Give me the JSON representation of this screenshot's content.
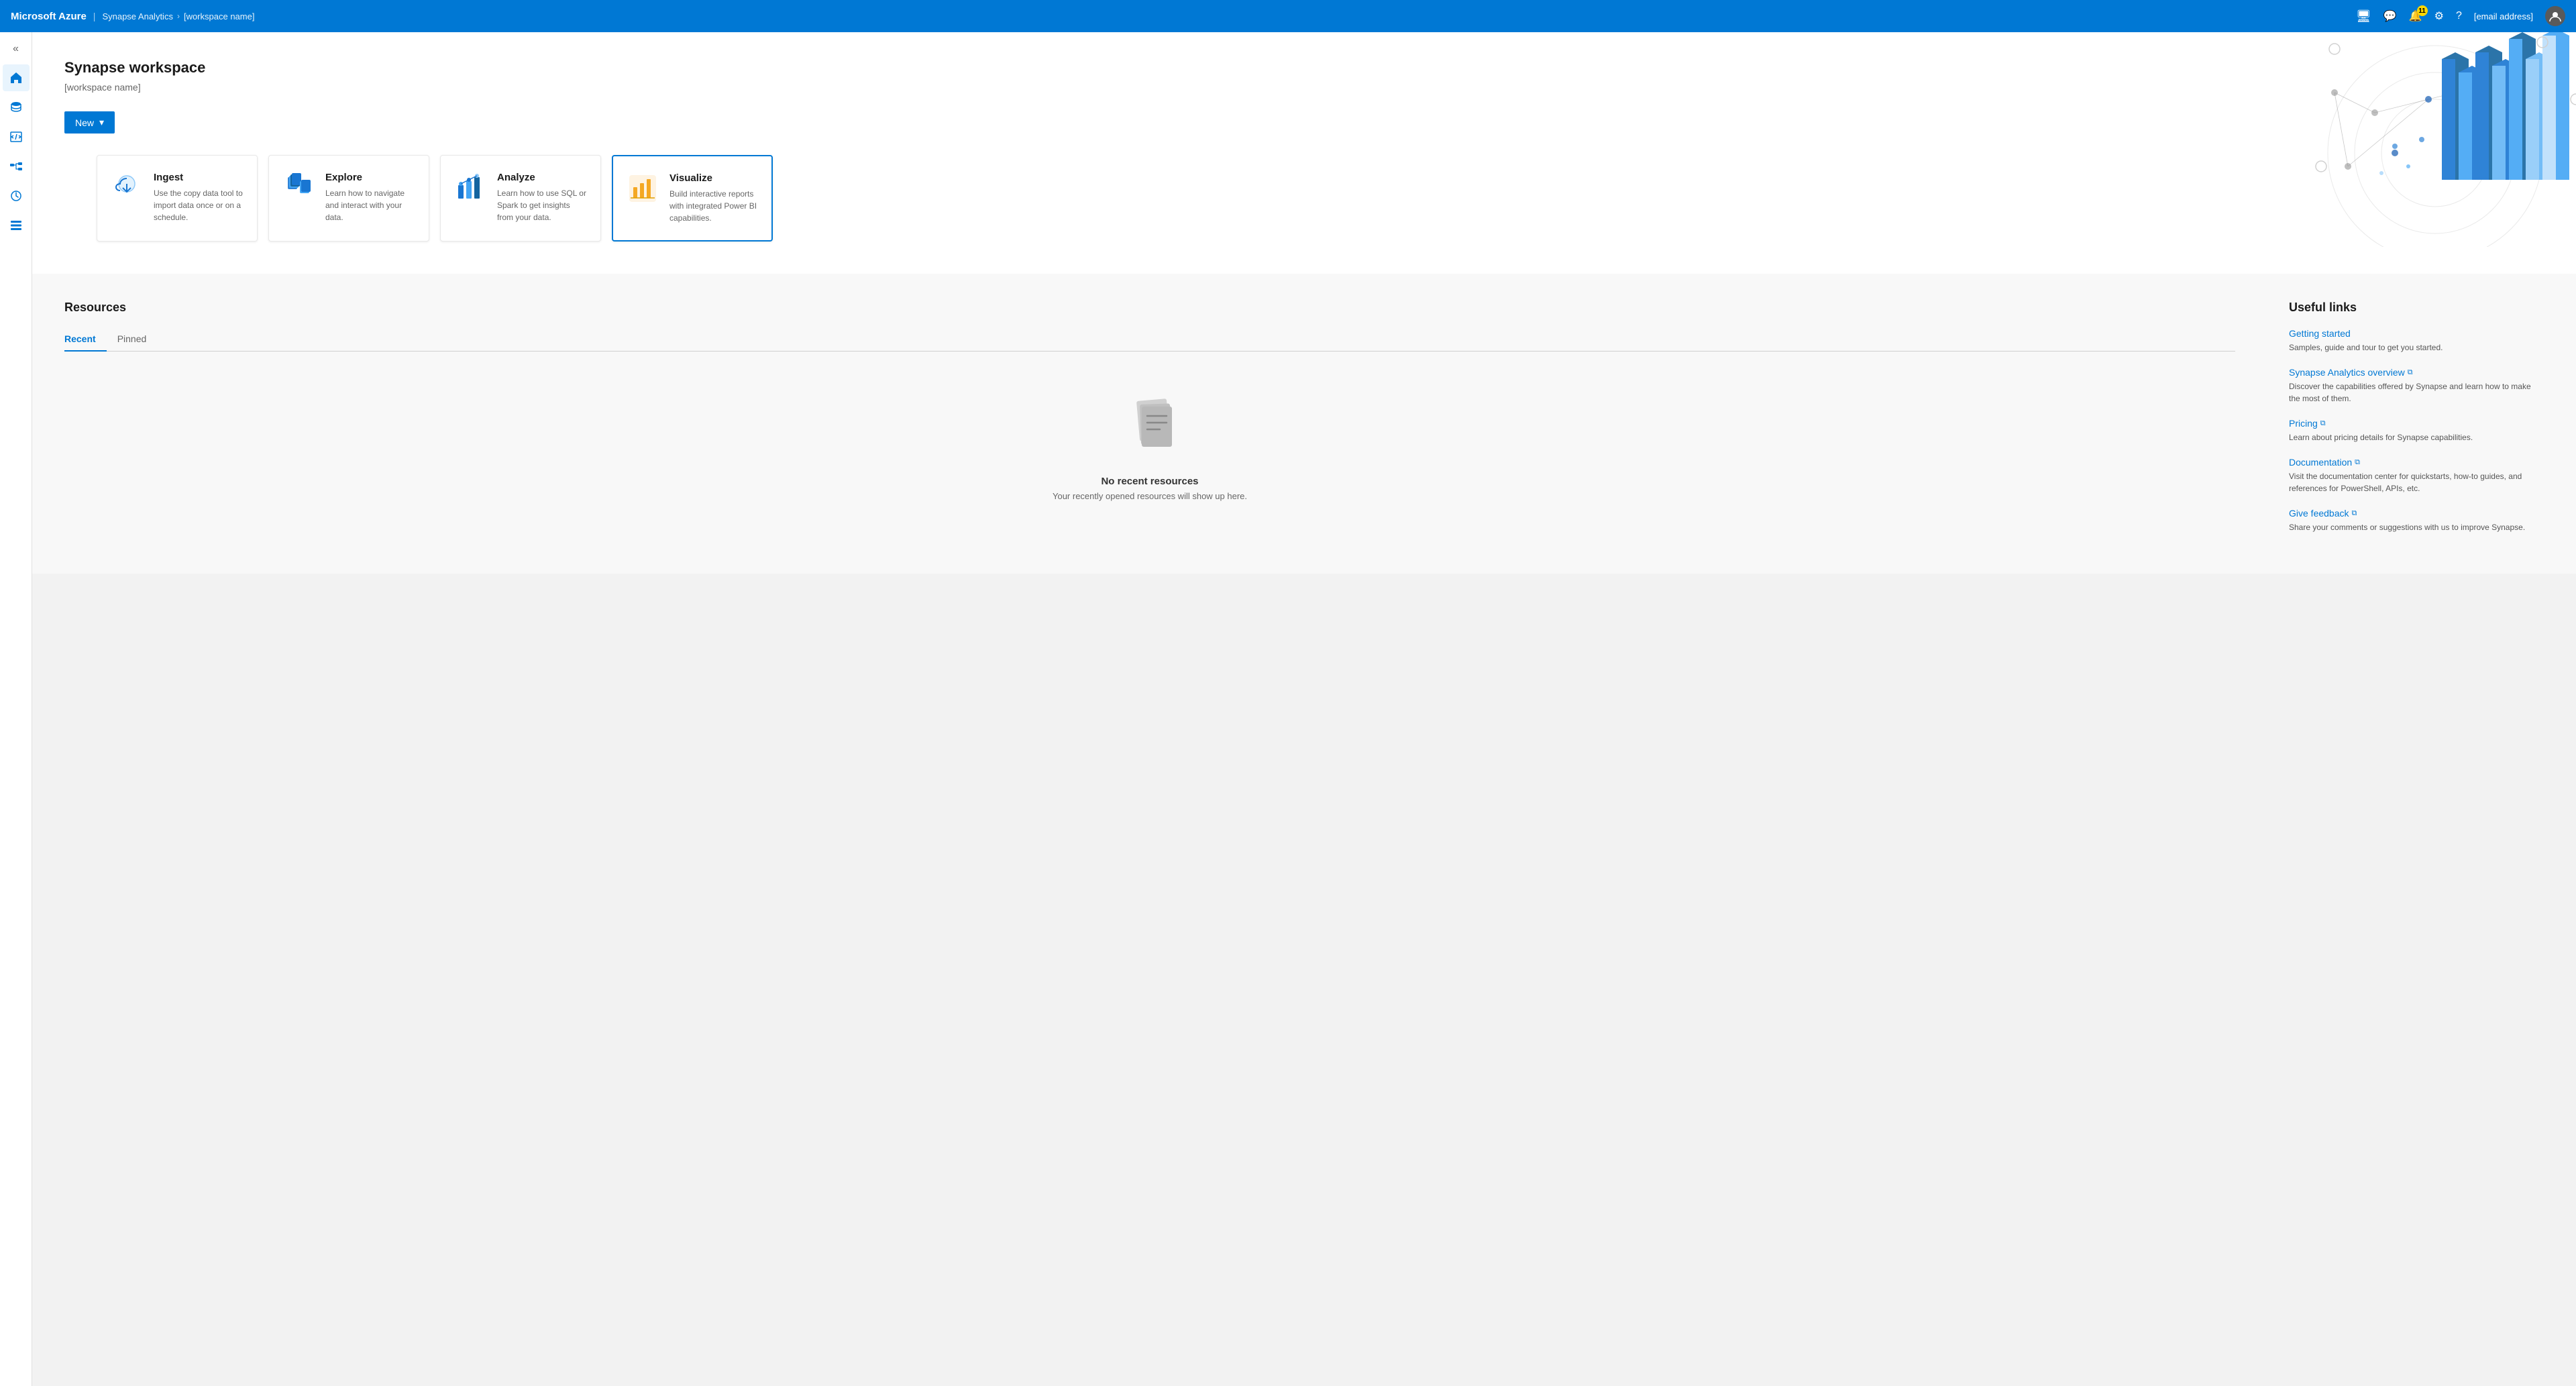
{
  "app": {
    "brand": "Microsoft Azure",
    "separator": "|",
    "nav_item1": "Synapse Analytics",
    "nav_arrow": "›",
    "nav_item2": "[workspace name]"
  },
  "topnav": {
    "notification_count": "11",
    "user_email": "[email address]"
  },
  "topnav_icons": [
    {
      "name": "cloud-icon",
      "symbol": "⊞"
    },
    {
      "name": "feedback-icon",
      "symbol": "💬"
    },
    {
      "name": "bell-icon",
      "symbol": "🔔"
    },
    {
      "name": "person-icon",
      "symbol": "👤"
    },
    {
      "name": "help-icon",
      "symbol": "?"
    }
  ],
  "sidebar": {
    "toggle_label": "«",
    "items": [
      {
        "name": "home",
        "icon": "⌂",
        "label": "Home"
      },
      {
        "name": "data",
        "icon": "🗄",
        "label": "Data"
      },
      {
        "name": "develop",
        "icon": "📄",
        "label": "Develop"
      },
      {
        "name": "integrate",
        "icon": "🔗",
        "label": "Integrate"
      },
      {
        "name": "monitor",
        "icon": "⏱",
        "label": "Monitor"
      },
      {
        "name": "manage",
        "icon": "💼",
        "label": "Manage"
      }
    ]
  },
  "hero": {
    "title": "Synapse workspace",
    "subtitle": "[workspace name]",
    "new_button": "New",
    "new_button_arrow": "▾"
  },
  "action_cards": [
    {
      "id": "ingest",
      "title": "Ingest",
      "description": "Use the copy data tool to import data once or on a schedule.",
      "icon_color": "#0078d4"
    },
    {
      "id": "explore",
      "title": "Explore",
      "description": "Learn how to navigate and interact with your data.",
      "icon_color": "#0078d4"
    },
    {
      "id": "analyze",
      "title": "Analyze",
      "description": "Learn how to use SQL or Spark to get insights from your data.",
      "icon_color": "#0078d4"
    },
    {
      "id": "visualize",
      "title": "Visualize",
      "description": "Build interactive reports with integrated Power BI capabilities.",
      "icon_color": "#f4b400",
      "highlighted": true
    }
  ],
  "resources": {
    "title": "Resources",
    "tabs": [
      {
        "id": "recent",
        "label": "Recent",
        "active": true
      },
      {
        "id": "pinned",
        "label": "Pinned",
        "active": false
      }
    ],
    "empty_title": "No recent resources",
    "empty_desc": "Your recently opened resources will show up here."
  },
  "useful_links": {
    "title": "Useful links",
    "items": [
      {
        "id": "getting-started",
        "title": "Getting started",
        "description": "Samples, guide and tour to get you started.",
        "external": false
      },
      {
        "id": "synapse-overview",
        "title": "Synapse Analytics overview",
        "description": "Discover the capabilities offered by Synapse and learn how to make the most of them.",
        "external": true
      },
      {
        "id": "pricing",
        "title": "Pricing",
        "description": "Learn about pricing details for Synapse capabilities.",
        "external": true
      },
      {
        "id": "documentation",
        "title": "Documentation",
        "description": "Visit the documentation center for quickstarts, how-to guides, and references for PowerShell, APIs, etc.",
        "external": true
      },
      {
        "id": "give-feedback",
        "title": "Give feedback",
        "description": "Share your comments or suggestions with us to improve Synapse.",
        "external": true
      }
    ]
  }
}
